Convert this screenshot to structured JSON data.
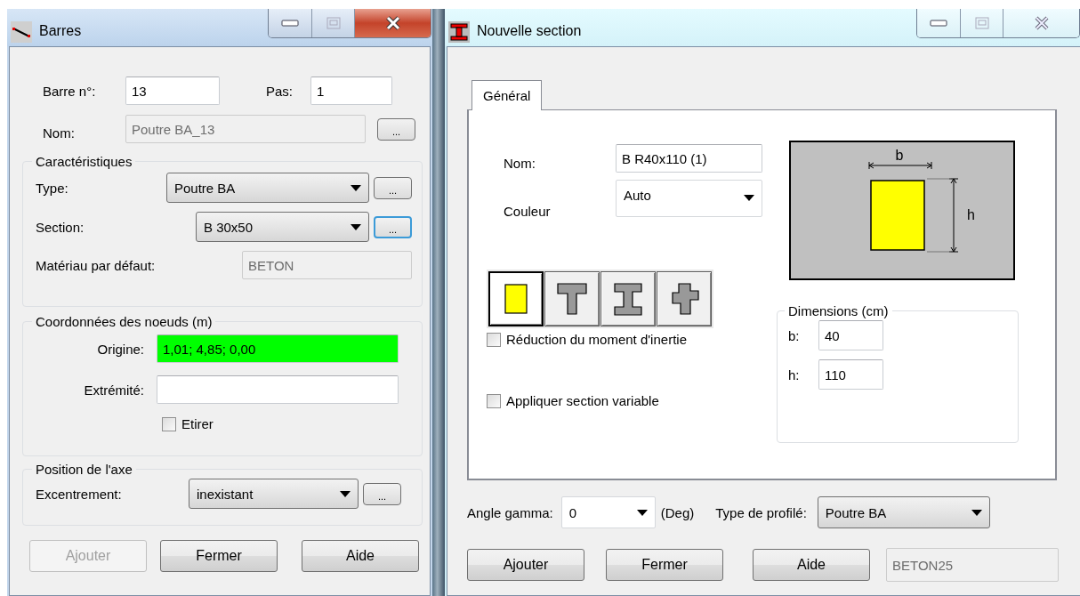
{
  "bar_window": {
    "title": "Barres",
    "bar_number": {
      "label": "Barre n°:",
      "value": "13"
    },
    "step": {
      "label": "Pas:",
      "value": "1"
    },
    "name": {
      "label": "Nom:",
      "value": "Poutre BA_13",
      "disabled": true,
      "button": "..."
    },
    "characteristics": {
      "title": "Caractéristiques",
      "type": {
        "label": "Type:",
        "value": "Poutre BA",
        "button": "...",
        "focused": false
      },
      "section": {
        "label": "Section:",
        "value": "B 30x50",
        "button": "...",
        "focused": true
      },
      "material": {
        "label": "Matériau par défaut:",
        "value": "BETON",
        "disabled": true
      }
    },
    "coordinates": {
      "title": "Coordonnées des noeuds (m)",
      "origin": {
        "label": "Origine:",
        "value": "1,01; 4,85; 0,00",
        "highlighted": true
      },
      "end": {
        "label": "Extrémité:",
        "highlighted": false
      },
      "stretch": {
        "label": "Etirer",
        "checked": false
      }
    },
    "axis": {
      "title": "Position de l'axe",
      "eccentricity": {
        "label": "Excentrement:",
        "value": "inexistant",
        "button": "...",
        "focused": false
      }
    },
    "buttons": [
      {
        "label": "Ajouter",
        "disabled": true
      },
      {
        "label": "Fermer",
        "disabled": false
      },
      {
        "label": "Aide",
        "disabled": false
      }
    ]
  },
  "section_window": {
    "title": "Nouvelle section",
    "tabs": [
      {
        "label": "Général",
        "selected": true
      }
    ],
    "name": {
      "label": "Nom:",
      "value": "B R40x110 (1)"
    },
    "color": {
      "label": "Couleur",
      "value": "Auto"
    },
    "preview": {
      "width_label": "b",
      "height_label": "h"
    },
    "shapes": [
      {
        "kind": "rectangle",
        "selected": true
      },
      {
        "kind": "tee",
        "selected": false
      },
      {
        "kind": "ibeam",
        "selected": false
      },
      {
        "kind": "cross",
        "selected": false
      }
    ],
    "options": [
      {
        "label": "Réduction du moment d'inertie",
        "checked": false
      },
      {
        "label": "Appliquer section variable",
        "checked": false
      }
    ],
    "dimensions": {
      "title": "Dimensions (cm)",
      "fields": [
        {
          "label": "b:",
          "value": "40"
        },
        {
          "label": "h:",
          "value": "110"
        }
      ]
    },
    "angle": {
      "label": "Angle gamma:",
      "value": "0",
      "unit": "(Deg)"
    },
    "profile_type": {
      "label": "Type de profilé:",
      "value": "Poutre BA"
    },
    "buttons": [
      {
        "label": "Ajouter",
        "disabled": false
      },
      {
        "label": "Fermer",
        "disabled": false
      },
      {
        "label": "Aide",
        "disabled": false
      }
    ],
    "material": {
      "value": "BETON25",
      "disabled": true
    }
  }
}
